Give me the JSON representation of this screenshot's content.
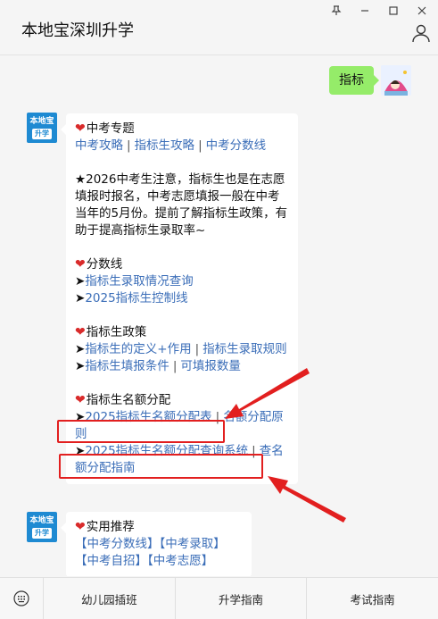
{
  "header": {
    "title": "本地宝深圳升学",
    "window_buttons": [
      "pin-icon",
      "minimize-icon",
      "maximize-icon",
      "close-icon"
    ]
  },
  "chat": {
    "user_message": "指标",
    "bot_avatar": {
      "line1": "本地宝",
      "line2": "升学"
    },
    "message1": {
      "section1_title": "中考专题",
      "section1_links": [
        "中考攻略",
        "指标生攻略",
        "中考分数线"
      ],
      "notice": "★2026中考生注意，指标生也是在志愿填报时报名，中考志愿填报一般在中考当年的5月份。提前了解指标生政策，有助于提高指标生录取率~",
      "section2_title": "分数线",
      "section2_links": [
        "指标生录取情况查询",
        "2025指标生控制线"
      ],
      "section3_title": "指标生政策",
      "section3_link_a": "指标生的定义+作用",
      "section3_link_b": "指标生录取规则",
      "section3_link_c": "指标生填报条件",
      "section3_link_d": "可填报数量",
      "section4_title": "指标生名额分配",
      "section4_link_a": "2025指标生名额分配表",
      "section4_link_b": "名额分配原则",
      "section4_link_c": "2025指标生名额分配查询系统",
      "section4_link_d": "查名额分配指南",
      "arrow_char": "➤",
      "separator": "|"
    },
    "message2": {
      "title": "实用推荐",
      "row1": [
        "【中考分数线】",
        "【中考录取】"
      ],
      "row2": [
        "【中考自招】",
        "【中考志愿】"
      ]
    }
  },
  "menu": {
    "keyboard_icon": "keyboard-icon",
    "items": [
      "幼儿园插班",
      "升学指南",
      "考试指南"
    ]
  },
  "colors": {
    "link": "#3b6eb8",
    "user_bubble": "#95ec69",
    "highlight": "#e21f1f",
    "heart": "#d92b2b"
  }
}
